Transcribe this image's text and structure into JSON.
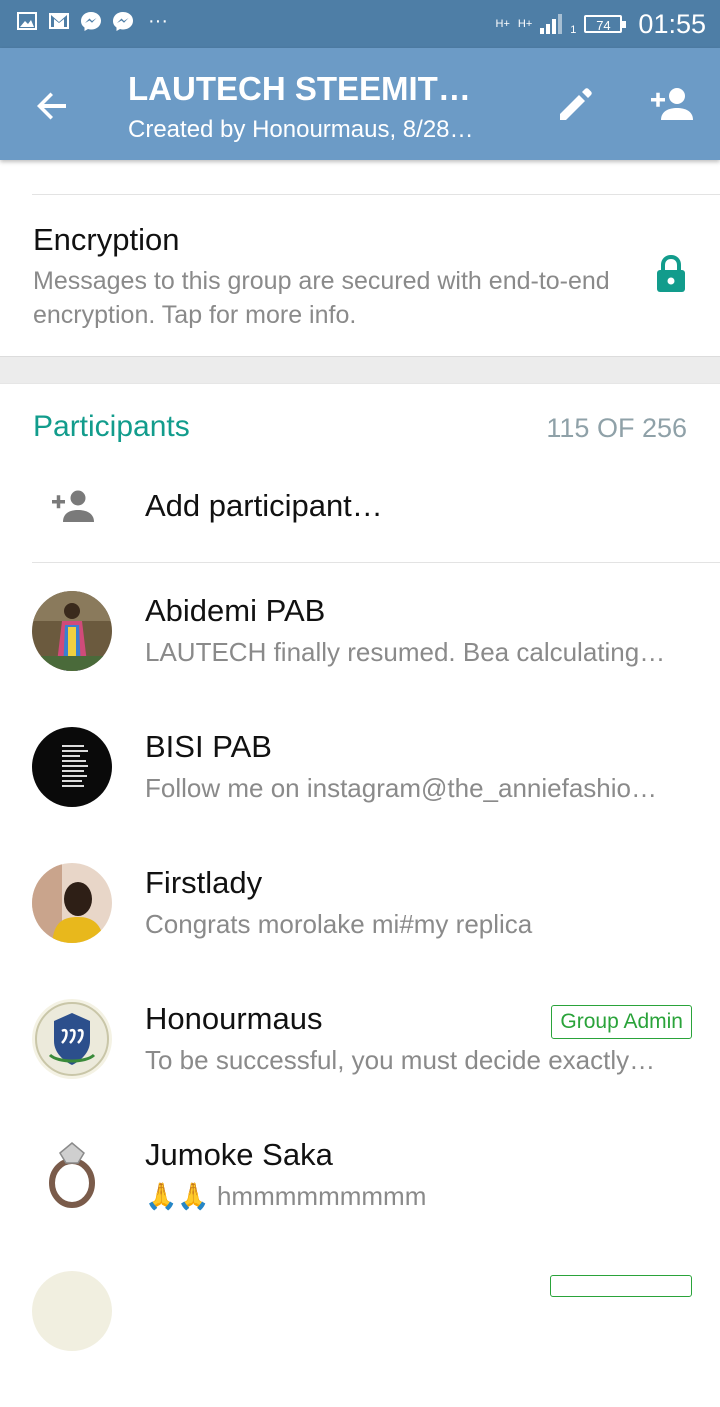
{
  "status_bar": {
    "notification_icons": [
      "gallery-icon",
      "gmail-icon",
      "messenger-icon",
      "messenger-icon"
    ],
    "more": "···",
    "network": "H+",
    "sim": "1",
    "battery": "74",
    "time": "01:55"
  },
  "app_bar": {
    "title": "LAUTECH STEEMIT…",
    "subtitle": "Created by Honourmaus, 8/28…"
  },
  "encryption": {
    "title": "Encryption",
    "text": "Messages to this group are secured with end-to-end encryption. Tap for more info."
  },
  "participants": {
    "header": "Participants",
    "count": "115 OF 256",
    "add_label": "Add participant…",
    "members": [
      {
        "name": "Abidemi PAB",
        "status": "LAUTECH finally resumed. Bea calculating…",
        "admin": ""
      },
      {
        "name": "BISI PAB",
        "status": "Follow me on instagram@the_anniefashio…",
        "admin": ""
      },
      {
        "name": "Firstlady",
        "status": "Congrats morolake mi#my replica",
        "admin": ""
      },
      {
        "name": "Honourmaus",
        "status": "To be successful, you must decide exactly…",
        "admin": "Group Admin"
      },
      {
        "name": "Jumoke Saka",
        "status": "🙏🙏 hmmmmmmmmm",
        "admin": ""
      }
    ]
  },
  "colors": {
    "status_bar": "#4e7ea6",
    "app_bar": "#6c9bc6",
    "accent": "#129c8c",
    "admin": "#2aa33a"
  }
}
